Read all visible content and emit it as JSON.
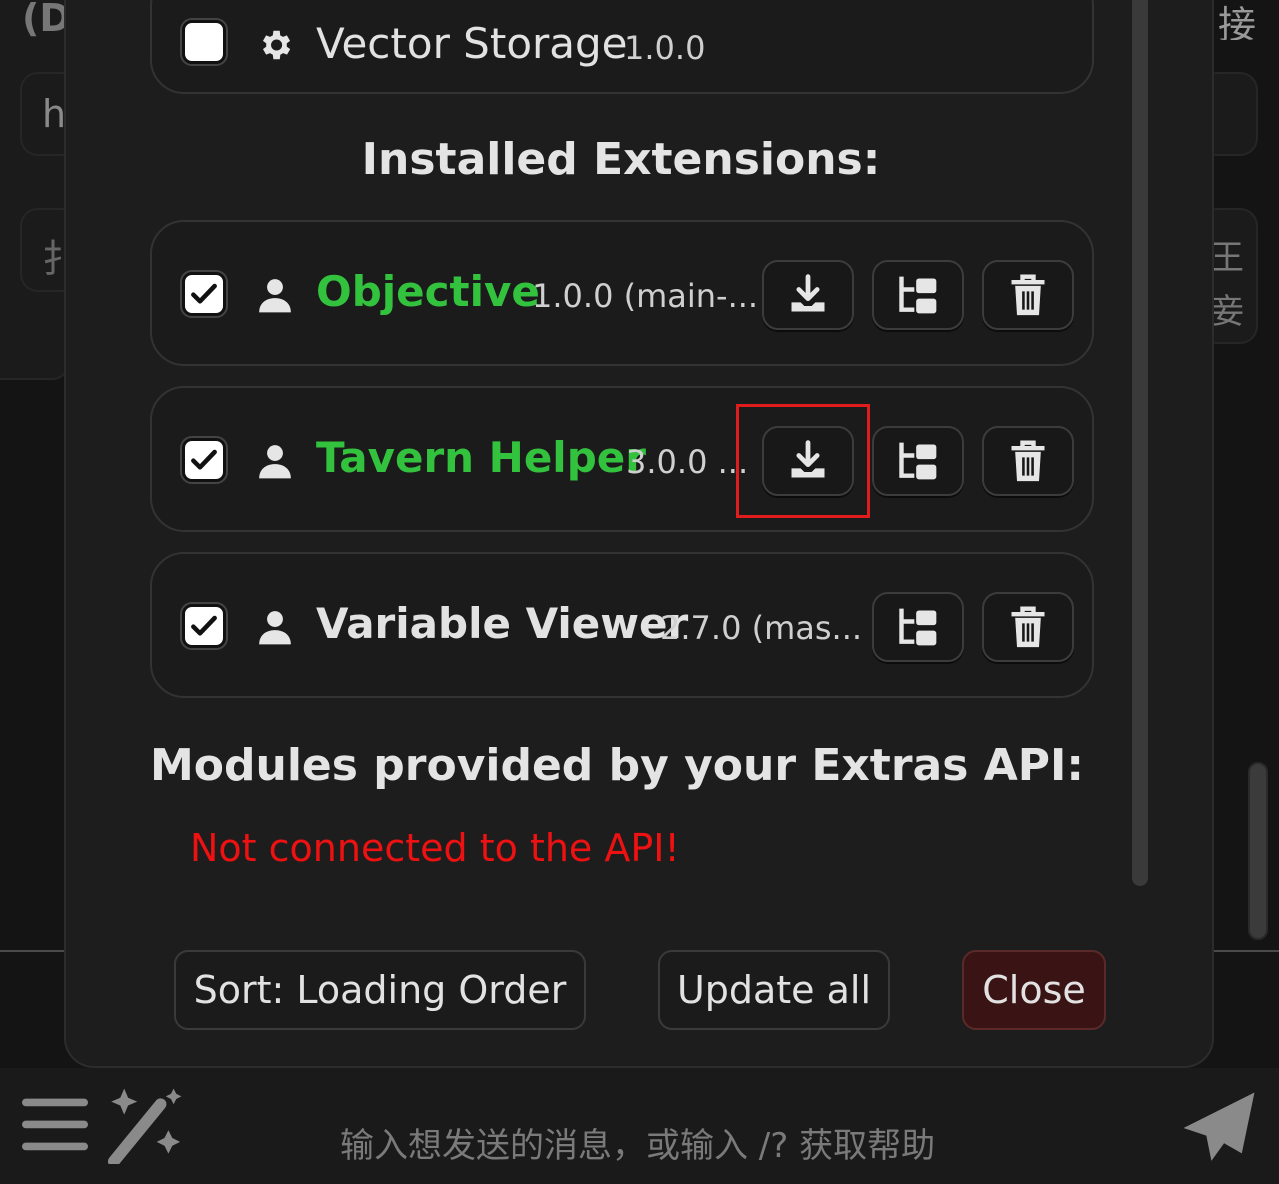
{
  "background": {
    "left_top_text": "(D",
    "left_input_text": "h",
    "left_tab_text": "扌",
    "right_top_text": "接",
    "right_side_text_1": "王",
    "right_side_text_2": "妾"
  },
  "top_extension": {
    "name": "Vector Storage",
    "version": "1.0.0",
    "enabled": false,
    "icon": "gear-icon"
  },
  "installed_heading": "Installed Extensions:",
  "installed_extensions": [
    {
      "name": "Objective",
      "version": "1.0.0 (main-...",
      "enabled": true,
      "icon": "user-icon",
      "name_color": "#33c23d",
      "has_update_button": true
    },
    {
      "name": "Tavern Helper",
      "version": "3.0.0 ...",
      "enabled": true,
      "icon": "user-icon",
      "name_color": "#33c23d",
      "has_update_button": true,
      "update_highlighted": true
    },
    {
      "name": "Variable Viewer",
      "version": "2.7.0 (mas...",
      "enabled": true,
      "icon": "user-icon",
      "name_color": "#e2e2e2",
      "has_update_button": false
    }
  ],
  "modules_heading": "Modules provided by your Extras API:",
  "modules_error": "Not connected to the API!",
  "footer": {
    "sort_label": "Sort: Loading Order",
    "update_all_label": "Update all",
    "close_label": "Close"
  },
  "chat_input": {
    "placeholder": "输入想发送的消息，或输入 /? 获取帮助"
  },
  "colors": {
    "accent_green": "#33c23d",
    "error_red": "#ee1111",
    "highlight_red": "#e01c1c",
    "close_button_bg": "#3a1414"
  }
}
